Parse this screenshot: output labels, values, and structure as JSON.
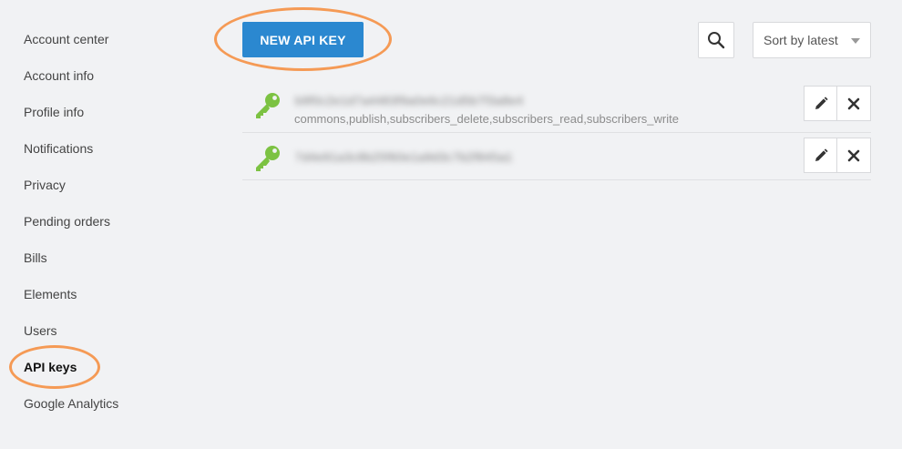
{
  "sidebar": {
    "items": [
      {
        "label": "Account center"
      },
      {
        "label": "Account info"
      },
      {
        "label": "Profile info"
      },
      {
        "label": "Notifications"
      },
      {
        "label": "Privacy"
      },
      {
        "label": "Pending orders"
      },
      {
        "label": "Bills"
      },
      {
        "label": "Elements"
      },
      {
        "label": "Users"
      },
      {
        "label": "API keys",
        "active": true
      },
      {
        "label": "Google Analytics"
      }
    ]
  },
  "toolbar": {
    "new_key_label": "NEW API KEY",
    "sort_label": "Sort by latest"
  },
  "api_keys": [
    {
      "value": "b9f0c2e1d7a4483f9a0e6c21d5b7f3a8e4",
      "scopes": "commons,publish,subscribers_delete,subscribers_read,subscribers_write"
    },
    {
      "value": "7d4e91a3c8b25f60e1a9d3c7b2f845a1"
    }
  ],
  "colors": {
    "accent": "#2b88d0",
    "highlight": "#f59a55",
    "key_icon": "#7cc242"
  },
  "icons": {
    "search": "search-icon",
    "key": "key-icon",
    "edit": "pencil-icon",
    "delete": "close-icon",
    "sort_caret": "caret-down-icon"
  }
}
